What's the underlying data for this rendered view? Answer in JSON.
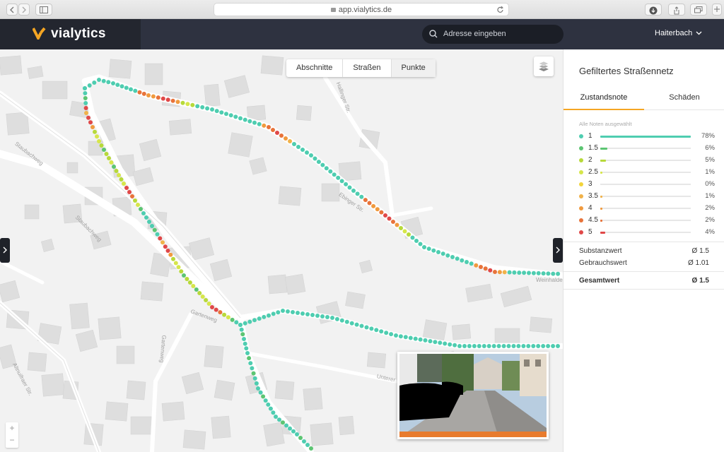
{
  "browser": {
    "url": "app.vialytics.de"
  },
  "app": {
    "logo": "vialytics",
    "search_placeholder": "Adresse eingeben",
    "location": "Haiterbach"
  },
  "map": {
    "modes": [
      "Abschnitte",
      "Straßen",
      "Punkte"
    ],
    "active_mode": "Punkte",
    "street_labels": [
      "Staubachweg",
      "Staubachweg",
      "Gartenweg",
      "Gartenweg",
      "Altnuifraer Str.",
      "Hallinger Str.",
      "Unterer",
      "Weinhalde",
      "Ebinger Str."
    ],
    "zoom": {
      "in": "+",
      "out": "−"
    }
  },
  "panel": {
    "title": "Gefiltertes Straßennetz",
    "tabs": [
      "Zustandsnote",
      "Schäden"
    ],
    "active_tab": "Zustandsnote",
    "filter_hint": "Alle Noten ausgewählt",
    "grades": [
      {
        "label": "1",
        "percent": "78%",
        "value": 78,
        "color": "#4ecdb0"
      },
      {
        "label": "1.5",
        "percent": "6%",
        "value": 6,
        "color": "#5cc572"
      },
      {
        "label": "2",
        "percent": "5%",
        "value": 5,
        "color": "#b7d93a"
      },
      {
        "label": "2.5",
        "percent": "1%",
        "value": 1,
        "color": "#d6e64a"
      },
      {
        "label": "3",
        "percent": "0%",
        "value": 0,
        "color": "#f2d43a"
      },
      {
        "label": "3.5",
        "percent": "1%",
        "value": 1,
        "color": "#f0b24a"
      },
      {
        "label": "4",
        "percent": "2%",
        "value": 2,
        "color": "#f09a3e"
      },
      {
        "label": "4.5",
        "percent": "2%",
        "value": 2,
        "color": "#e8733a"
      },
      {
        "label": "5",
        "percent": "4%",
        "value": 4,
        "color": "#e04848"
      }
    ],
    "stats": {
      "substanz_label": "Substanzwert",
      "substanz_value": "Ø 1.5",
      "gebrauch_label": "Gebrauchswert",
      "gebrauch_value": "Ø 1.01",
      "gesamt_label": "Gesamtwert",
      "gesamt_value": "Ø 1.5"
    }
  },
  "colors": {
    "header": "#2e3240",
    "accent": "#f5a623"
  }
}
